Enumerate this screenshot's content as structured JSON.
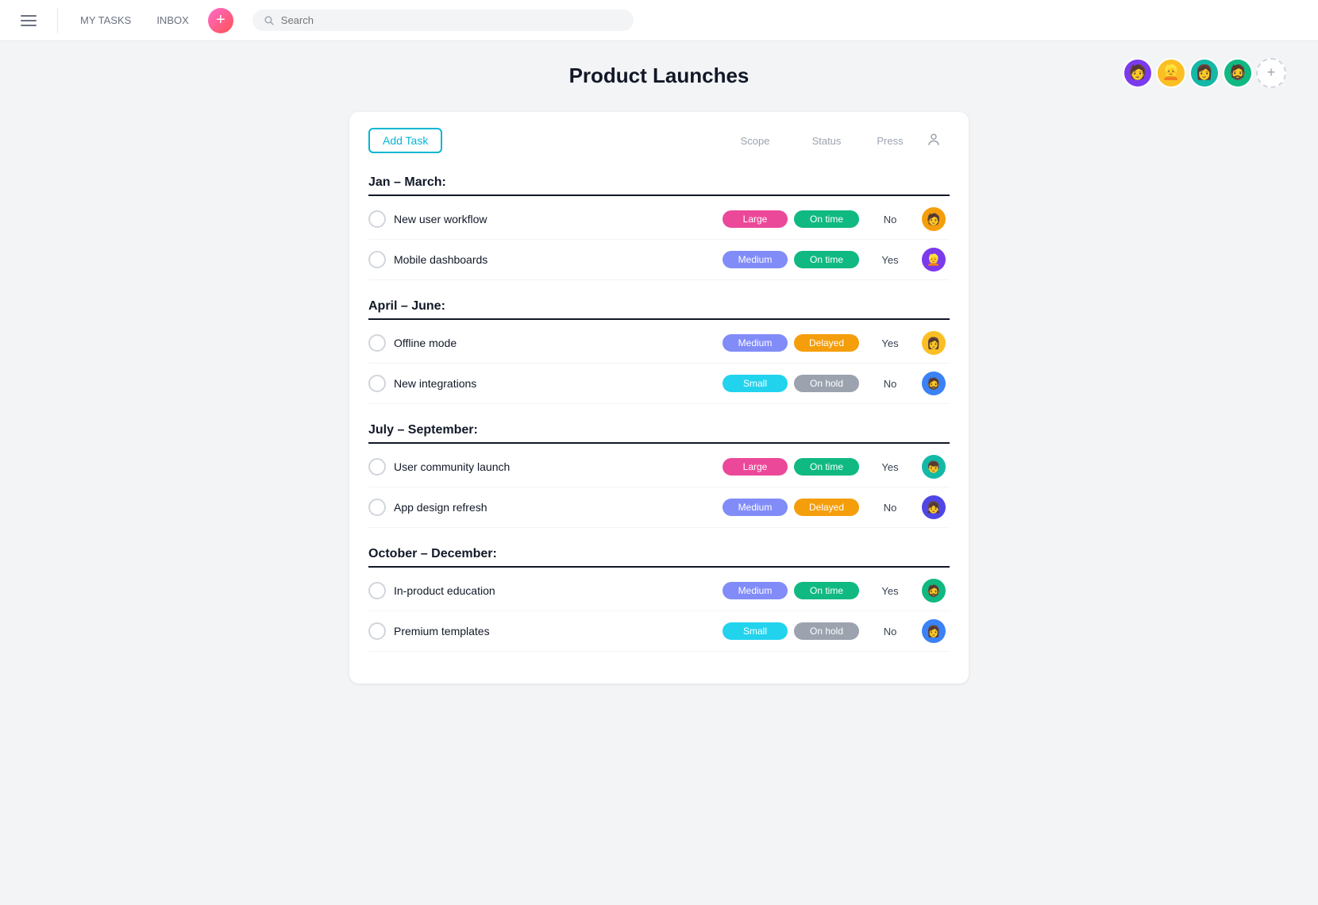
{
  "nav": {
    "my_tasks": "MY TASKS",
    "inbox": "INBOX",
    "search_placeholder": "Search"
  },
  "page": {
    "title": "Product Launches"
  },
  "toolbar": {
    "add_task_label": "Add Task",
    "col_scope": "Scope",
    "col_status": "Status",
    "col_press": "Press"
  },
  "sections": [
    {
      "title": "Jan – March:",
      "tasks": [
        {
          "name": "New user workflow",
          "scope": "Large",
          "scope_class": "badge-large",
          "status": "On time",
          "status_class": "badge-on-time",
          "press": "No",
          "avatar_class": "av-orange",
          "avatar_emoji": "👤"
        },
        {
          "name": "Mobile dashboards",
          "scope": "Medium",
          "scope_class": "badge-medium",
          "status": "On time",
          "status_class": "badge-on-time",
          "press": "Yes",
          "avatar_class": "av-purple",
          "avatar_emoji": "👤"
        }
      ]
    },
    {
      "title": "April – June:",
      "tasks": [
        {
          "name": "Offline mode",
          "scope": "Medium",
          "scope_class": "badge-medium",
          "status": "Delayed",
          "status_class": "badge-delayed",
          "press": "Yes",
          "avatar_class": "av-yellow",
          "avatar_emoji": "👤"
        },
        {
          "name": "New integrations",
          "scope": "Small",
          "scope_class": "badge-small",
          "status": "On hold",
          "status_class": "badge-on-hold",
          "press": "No",
          "avatar_class": "av-blue",
          "avatar_emoji": "👤"
        }
      ]
    },
    {
      "title": "July – September:",
      "tasks": [
        {
          "name": "User community launch",
          "scope": "Large",
          "scope_class": "badge-large",
          "status": "On time",
          "status_class": "badge-on-time",
          "press": "Yes",
          "avatar_class": "av-teal",
          "avatar_emoji": "👤"
        },
        {
          "name": "App design refresh",
          "scope": "Medium",
          "scope_class": "badge-medium",
          "status": "Delayed",
          "status_class": "badge-delayed",
          "press": "No",
          "avatar_class": "av-indigo",
          "avatar_emoji": "👤"
        }
      ]
    },
    {
      "title": "October – December:",
      "tasks": [
        {
          "name": "In-product education",
          "scope": "Medium",
          "scope_class": "badge-medium",
          "status": "On time",
          "status_class": "badge-on-time",
          "press": "Yes",
          "avatar_class": "av-green",
          "avatar_emoji": "👤"
        },
        {
          "name": "Premium templates",
          "scope": "Small",
          "scope_class": "badge-small",
          "status": "On hold",
          "status_class": "badge-on-hold",
          "press": "No",
          "avatar_class": "av-blue",
          "avatar_emoji": "👤"
        }
      ]
    }
  ],
  "avatars": {
    "user1_emoji": "🧑",
    "user2_emoji": "👱",
    "user3_emoji": "👩",
    "user4_emoji": "🧔"
  }
}
